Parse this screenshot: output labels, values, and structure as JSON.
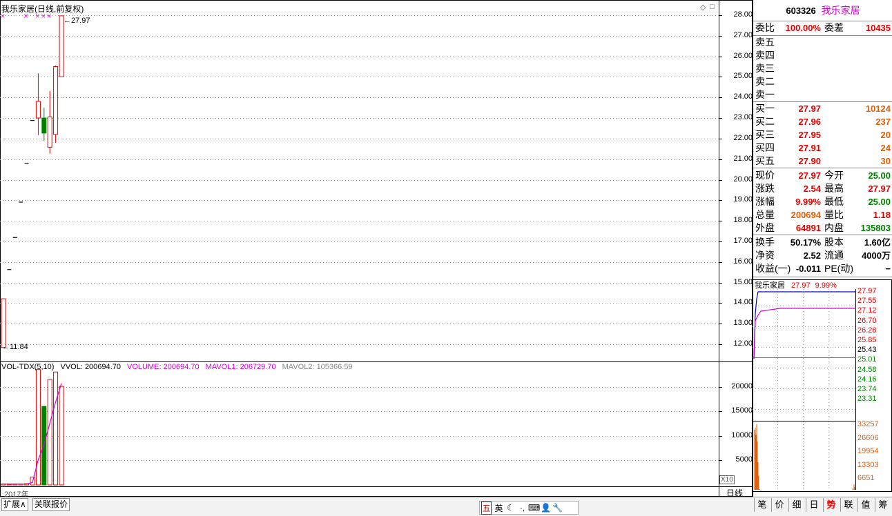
{
  "chart_title": "我乐家居(日线,前复权)",
  "top_icons": [
    "diamond-icon",
    "square-icon"
  ],
  "price_labels": {
    "high": "27.97",
    "low": "11.84"
  },
  "y_axis": [
    "28.00",
    "27.00",
    "26.00",
    "25.00",
    "24.00",
    "23.00",
    "22.00",
    "21.00",
    "20.00",
    "19.00",
    "18.00",
    "17.00",
    "16.00",
    "15.00",
    "14.00",
    "13.00",
    "12.00"
  ],
  "vol_legend": {
    "name": "VOL-TDX(5,10)",
    "vvol": "VVOL: 200694.70",
    "volume": "VOLUME: 200694.70",
    "mavol1": "MAVOL1: 206729.70",
    "mavol2": "MAVOL2: 105366.59"
  },
  "vol_axis": [
    "20000",
    "15000",
    "10000",
    "5000"
  ],
  "x10": "X10",
  "year_label": "2017年",
  "period_label": "日线",
  "chart_data": {
    "type": "candlestick",
    "title": "我乐家居(日线,前复权)",
    "ylim": [
      11.5,
      28.2
    ],
    "candles": [
      {
        "o": 11.84,
        "c": 14.21,
        "h": 14.21,
        "l": 11.84
      },
      {
        "o": 15.63,
        "c": 15.63,
        "h": 15.63,
        "l": 15.63
      },
      {
        "o": 17.19,
        "c": 17.19,
        "h": 17.19,
        "l": 17.19
      },
      {
        "o": 18.91,
        "c": 18.91,
        "h": 18.91,
        "l": 18.91
      },
      {
        "o": 20.8,
        "c": 20.8,
        "h": 20.8,
        "l": 20.8
      },
      {
        "o": 22.88,
        "c": 22.88,
        "h": 22.88,
        "l": 22.88
      },
      {
        "o": 23.0,
        "c": 23.81,
        "h": 25.17,
        "l": 22.17
      },
      {
        "o": 23.0,
        "c": 22.27,
        "h": 23.5,
        "l": 21.88
      },
      {
        "o": 21.58,
        "c": 23.05,
        "h": 24.31,
        "l": 21.27
      },
      {
        "o": 22.2,
        "c": 25.5,
        "h": 25.55,
        "l": 21.8
      },
      {
        "o": 25.0,
        "c": 27.97,
        "h": 27.97,
        "l": 25.0
      }
    ],
    "volume": {
      "series": [
        {
          "name": "VOLUME",
          "values": [
            200,
            180,
            190,
            210,
            260,
            1600,
            23500,
            16000,
            21500,
            23000,
            20069
          ]
        },
        {
          "name": "MAVOL1",
          "values": [
            200,
            195,
            193,
            197,
            208,
            488,
            5152,
            8252,
            12572,
            16920,
            20673
          ]
        }
      ],
      "ylim": [
        0,
        25000
      ]
    }
  },
  "right_panel": {
    "code": "603326",
    "name": "我乐家居",
    "weibi_label": "委比",
    "weibi": "100.00%",
    "weicha_label": "委差",
    "weicha": "10435",
    "sell": [
      {
        "label": "卖五"
      },
      {
        "label": "卖四"
      },
      {
        "label": "卖三"
      },
      {
        "label": "卖二"
      },
      {
        "label": "卖一"
      }
    ],
    "buy": [
      {
        "label": "买一",
        "price": "27.97",
        "vol": "10124"
      },
      {
        "label": "买二",
        "price": "27.96",
        "vol": "237"
      },
      {
        "label": "买三",
        "price": "27.95",
        "vol": "20"
      },
      {
        "label": "买四",
        "price": "27.91",
        "vol": "24"
      },
      {
        "label": "买五",
        "price": "27.90",
        "vol": "30"
      }
    ],
    "stats": [
      {
        "l1": "现价",
        "v1": "27.97",
        "c1": "red",
        "l2": "今开",
        "v2": "25.00",
        "c2": "green"
      },
      {
        "l1": "涨跌",
        "v1": "2.54",
        "c1": "red",
        "l2": "最高",
        "v2": "27.97",
        "c2": "red"
      },
      {
        "l1": "涨幅",
        "v1": "9.99%",
        "c1": "red",
        "l2": "最低",
        "v2": "25.00",
        "c2": "green"
      },
      {
        "l1": "总量",
        "v1": "200694",
        "c1": "orange",
        "l2": "量比",
        "v2": "1.18",
        "c2": "red"
      },
      {
        "l1": "外盘",
        "v1": "64891",
        "c1": "red",
        "l2": "内盘",
        "v2": "135803",
        "c2": "green"
      }
    ],
    "fund": [
      {
        "l1": "换手",
        "v1": "50.17%",
        "l2": "股本",
        "v2": "1.60亿"
      },
      {
        "l1": "净资",
        "v1": "2.52",
        "l2": "流通",
        "v2": "4000万"
      },
      {
        "l1": "收益(一)",
        "v1": "-0.011",
        "l2": "PE(动)",
        "v2": "−"
      }
    ]
  },
  "mini_chart": {
    "title_name": "我乐家居",
    "title_price": "27.97",
    "title_pct": "9.99%",
    "price_axis": [
      "27.97",
      "27.55",
      "27.12",
      "26.70",
      "26.28",
      "25.85",
      "25.43",
      "25.01",
      "24.58",
      "24.16",
      "23.74",
      "23.31"
    ],
    "vol_axis": [
      "33257",
      "26606",
      "19954",
      "13303",
      "6651"
    ]
  },
  "bottom_tabs": [
    "扩展∧",
    "关联报价"
  ],
  "ime": [
    "五",
    "英",
    "☾",
    "·,",
    "⌨",
    "👤",
    "🔧"
  ],
  "right_tabs": [
    "笔",
    "价",
    "细",
    "日",
    "势",
    "联",
    "值",
    "筹"
  ]
}
